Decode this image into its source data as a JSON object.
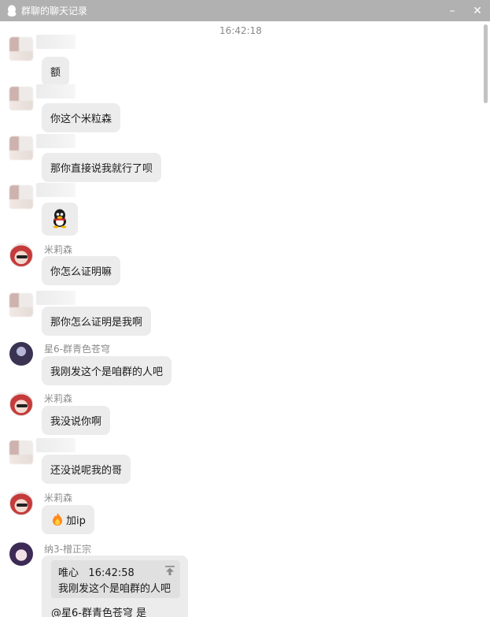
{
  "window": {
    "title": "群聊的聊天记录",
    "minimize_glyph": "–",
    "close_glyph": "✕"
  },
  "chat": {
    "timestamp": "16:42:18",
    "messages": [
      {
        "sender": "",
        "avatar": "blurred",
        "text": "额"
      },
      {
        "sender": "",
        "avatar": "blurred",
        "text": "你这个米粒森"
      },
      {
        "sender": "",
        "avatar": "blurred",
        "text": "那你直接说我就行了呗"
      },
      {
        "sender": "",
        "avatar": "blurred",
        "text": "",
        "sticker": "qq-penguin-icon"
      },
      {
        "sender": "米莉森",
        "avatar": "red-hair",
        "text": "你怎么证明嘛"
      },
      {
        "sender": "",
        "avatar": "blurred",
        "text": "那你怎么证明是我啊"
      },
      {
        "sender": "星6-群青色苍穹",
        "avatar": "dark",
        "text": "我刚发这个是咱群的人吧"
      },
      {
        "sender": "米莉森",
        "avatar": "red-hair",
        "text": "我没说你啊"
      },
      {
        "sender": "",
        "avatar": "blurred",
        "text": "还没说呢我的哥"
      },
      {
        "sender": "米莉森",
        "avatar": "red-hair",
        "text": "加ip",
        "emoji": "fire-icon"
      },
      {
        "sender": "纳3-橧正宗",
        "avatar": "purple",
        "quote": {
          "author": "唯心",
          "time": "16:42:58",
          "text": "我刚发这个是咱群的人吧"
        },
        "text": "@星6-群青色苍穹 是"
      }
    ]
  },
  "colors": {
    "titlebar": "#b1b1b1",
    "bubble": "#ececec",
    "quote": "#e0e0e0",
    "sender_text": "#8c8c8c"
  }
}
